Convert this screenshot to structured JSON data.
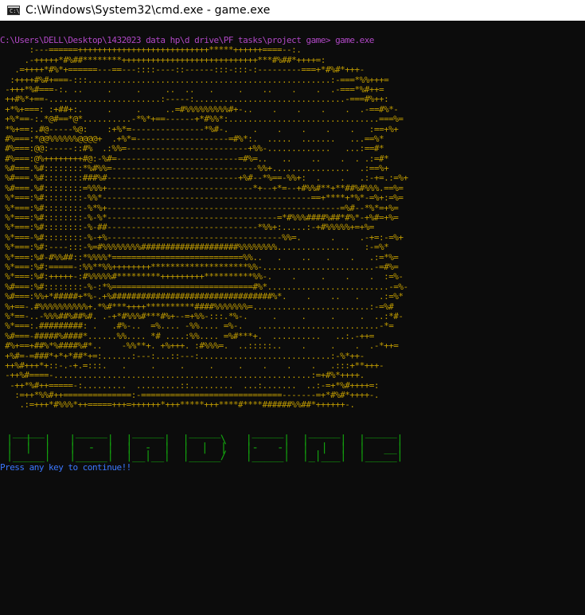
{
  "window": {
    "title": "C:\\Windows\\System32\\cmd.exe - game.exe",
    "icon": "cmd-window-icon",
    "icon_text": "C:\\"
  },
  "console": {
    "prompt": "C:\\Users\\DELL\\Desktop\\1432023 data hp\\d drive\\PF tasks\\project game> game.exe",
    "art_lines": [
      "      :---======+++++++++++++++++++++++++++*****++++++====--:.",
      "     .-+++++*#%##********++++++++++++++++++++++++++++***#%##*++++=:",
      "   .=++++*#%*+======---==---::::----::------:::-:::-:---------===+*#%#*+++-",
      "  :++++#%#+===-:::..................................................:-===*%%+++=",
      " -+++*%#===-:. ..     .     .     ..  ..   .     .    ..    .    .  .-===*%#++=",
      " ++#%*+==-.......................:-----:...............................-===#%++:",
      " +*%+===: :+##+:.     .     .     ..=#%%%%%%%%%#+-..    .    .    .    .  .-==#%*-",
      " +%*==-:.*@#==*@*..........-*%*+==------+*#%%*:...............................===%=",
      " *%+==:.#@-----%@:    :+%*=---------------*%#-.     .    .    .    .    .   :==+%+",
      " #%===:*@@%%%%%%@@@@+  .+%*=-------------------=#%*:.  .....  .......   ...==%*",
      " #%===:@@:-----::#%  .:%%=-------------------------+%%-.............   ...:==#*",
      " #%===:@%++++++++#@:-%#=-------------------------=#%=..   ..    ..    .  . .:=#*",
      " %#===.%#::::::::*%#%%=------------------------------%%+................  .:==%+",
      " %#===.%#::::::::###%#---------------------------+%#--*%==-%%+:  .    .   .:-+=.:=%+",
      " %#===.%#::::::::=%%%+------------------------------*+--+*=--+#%%#**+**##%#%%%.==%=",
      " %*===:%#::::::::-%%*-------------------------------------------==+****+*%*-=%+:=%=",
      " %*===:%#::::::::-%*%+------------------------------------------------=%#--*%*=+%=",
      " %*===:%#::::::::-%-%*-----------------------------------=*#%%%####%##*#%*-+%#=+%=",
      " %*===:%#::::::::-%-##-------------------------------*%%+:.....:-+#%%%%%+=+%=",
      " %*===-%#::::::::-%-+%------------------------------------%%=.      .     .-+=:-=%+",
      " %*===:%#:----:::-%=#%%%%%%%%####################%%%%%%%%...............   :-=%*",
      " %*===:%#-#%%##::*%%%%*===========================%%..   .    ..   .    .   .:=*%=",
      " %*===:%#:=====-:%%**%%++++++++********************%%-.......................-=#%=",
      " %*===:%#:+++++-:#%%%%%#*********+++++++++**********%%-.    .     .    .    .  :=%-",
      " %#===:%#::::::::-%-:*%=============================#%*.........................-=%-",
      " %#===:%%+*#####+*%-.+%#################################%*.    .    ..   .    .:=%*",
      " %+==-.#%%%%%%%%%%+.*%#***++++**********####%%%%%%%=........................:-=%#",
      " %*==-..-%%%##%##%#. .-+*#%%%#***#%+--=+%%-:::.*%-.     .     .     .     .  ..:*#-",
      " %*===:.#########: .   .#%-..  =%.... -%%.... =%-.   .........................-*=",
      " %#===-#####%####*......%%.... *# ....:%%.... =%#***+.  ..........   ..:.-++=",
      " #%+==+##%*%####%#*..    -%%**+. +%+++. :#%%%=.  ..:::::..    .     .    .  .-*++=",
      " +%#=-=###*+*+*##*+=:......:---:...::---:...........................:-%*++-",
      " ++%#+++*+::-.-+.=:::.   .     .     .     .     .    .    .    .   .:::+**+++-",
      " -++%#====-.....................................................:=+#%*++++.",
      "  -++*%#++=====-:.........  .........::.........  ...:.......  ..:-=+*%#++++=:",
      "   :=++*%%#++==============:-=============================-------=+*#%#*++++-.",
      "    .:=+++*#%%%*++=====+++=++++++*+++*****+++****#****######%%##*++++++-."
    ],
    "banner_lines": [
      "  _____     _____    _____    _____     _____    _____    _____",
      " |  |  |   |     |  |     |  |     \\   |     |  |     |  |     |",
      " |  |  |   |  -  |  |  -  |  |  |  |   |-   -|  |  |  |  |   __|",
      " |_____|   |_____|  |__|__|  |_____/   |_____|  |_|___|  |_____|"
    ],
    "press_message": "Press any key to continue!!"
  },
  "colors": {
    "prompt": "#b148c6",
    "art": "#c19c00",
    "banner": "#13a10e",
    "press": "#3b78ff",
    "background": "#0c0c0c"
  }
}
